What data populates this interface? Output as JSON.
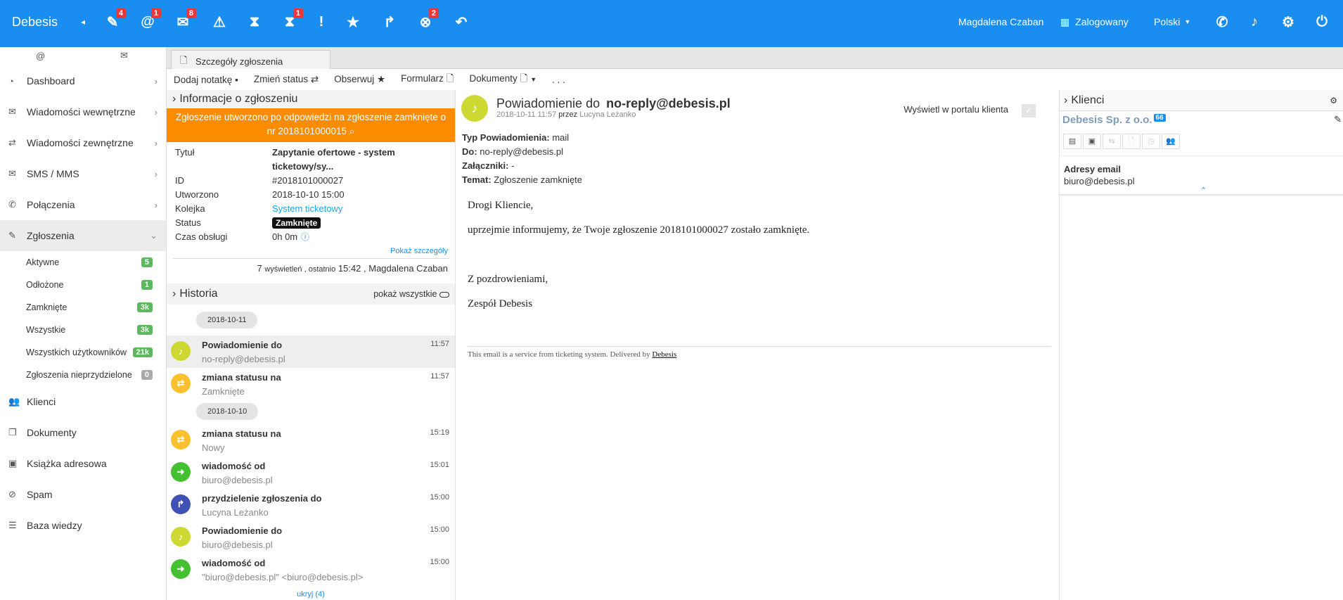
{
  "topbar": {
    "brand": "Debesis",
    "arrow": "◂",
    "badges": {
      "tickets": "4",
      "mentions": "1",
      "chat": "8",
      "timer2": "1",
      "close": "2"
    },
    "user": "Magdalena Czaban",
    "status": "Zalogowany",
    "language": "Polski",
    "bg": "#1a8ef0"
  },
  "sidebar": {
    "items": [
      {
        "label": "Dashboard"
      },
      {
        "label": "Wiadomości wewnętrzne"
      },
      {
        "label": "Wiadomości zewnętrzne"
      },
      {
        "label": "SMS / MMS"
      },
      {
        "label": "Połączenia"
      },
      {
        "label": "Zgłoszenia"
      }
    ],
    "subitems": [
      {
        "label": "Aktywne",
        "count": "5"
      },
      {
        "label": "Odłożone",
        "count": "1"
      },
      {
        "label": "Zamknięte",
        "count": "3k"
      },
      {
        "label": "Wszystkie",
        "count": "3k"
      },
      {
        "label": "Wszystkich użytkowników",
        "count": "21k"
      },
      {
        "label": "Zgłoszenia nieprzydzielone",
        "count": "0"
      }
    ],
    "bottom": [
      {
        "label": "Klienci"
      },
      {
        "label": "Dokumenty"
      },
      {
        "label": "Książka adresowa"
      },
      {
        "label": "Spam"
      },
      {
        "label": "Baza wiedzy"
      }
    ]
  },
  "tab": {
    "label": "Szczegóły zgłoszenia"
  },
  "toolbar": {
    "add_note": "Dodaj notatkę",
    "change_status": "Zmień status",
    "observe": "Obserwuj",
    "form": "Formularz",
    "documents": "Dokumenty",
    "more": ". . ."
  },
  "info": {
    "header": "Informacje o zgłoszeniu",
    "alert": "Zgłoszenie utworzono po odpowiedzi na zgłoszenie zamknięte o nr 2018101000015",
    "title_label": "Tytuł",
    "title_value": "Zapytanie ofertowe - system ticketowy/sy...",
    "id_label": "ID",
    "id_value": "#2018101000027",
    "created_label": "Utworzono",
    "created_value": "2018-10-10 15:00",
    "queue_label": "Kolejka",
    "queue_value": "System ticketowy",
    "status_label": "Status",
    "status_value": "Zamknięte",
    "time_label": "Czas obsługi",
    "time_value": "0h 0m",
    "show_details": "Pokaż szczegóły",
    "views_count": "7",
    "views_text": "wyświetleń , ostatnio",
    "views_time": "15:42 , Magdalena Czaban"
  },
  "history": {
    "header": "Historia",
    "toggle": "pokaż wszystkie",
    "date1": "2018-10-11",
    "date2": "2018-10-10",
    "hide": "ukryj (4)",
    "items": [
      {
        "title": "Powiadomienie do",
        "sub": "no-reply@debesis.pl",
        "time": "11:57"
      },
      {
        "title": "zmiana statusu na",
        "sub": "Zamknięte",
        "time": "11:57"
      },
      {
        "title": "zmiana statusu na",
        "sub": "Nowy",
        "time": "15:19"
      },
      {
        "title": "wiadomość od",
        "sub": "biuro@debesis.pl",
        "time": "15:01"
      },
      {
        "title": "przydzielenie zgłoszenia do",
        "sub": "Lucyna Leżanko",
        "time": "15:00"
      },
      {
        "title": "Powiadomienie do",
        "sub": "biuro@debesis.pl",
        "time": "15:00"
      },
      {
        "title": "wiadomość od",
        "sub": "\"biuro@debesis.pl\" <biuro@debesis.pl>",
        "time": "15:00"
      }
    ]
  },
  "message": {
    "title_prefix": "Powiadomienie do",
    "title_email": "no-reply@debesis.pl",
    "meta_date": "2018-10-11 11:57",
    "meta_by": "przez",
    "meta_author": "Lucyna Leżanko",
    "portal": "Wyświetl w portalu klienta",
    "type_label": "Typ Powiadomienia:",
    "type_value": "mail",
    "to_label": "Do:",
    "to_value": "no-reply@debesis.pl",
    "att_label": "Załączniki:",
    "att_value": "-",
    "subject_label": "Temat:",
    "subject_value": "Zgłoszenie zamknięte",
    "body1": "Drogi Kliencie,",
    "body2": "uprzejmie informujemy, że Twoje zgłoszenie 2018101000027 zostało zamknięte.",
    "body3": "Z pozdrowieniami,",
    "body4": "Zespół Debesis",
    "footer": "This email is a service from ticketing system. Delivered by",
    "footer_link": "Debesis"
  },
  "clients": {
    "header": "Klienci",
    "company": "Debesis Sp. z o.o.",
    "company_count": "66",
    "emails_label": "Adresy email",
    "email": "biuro@debesis.pl"
  }
}
